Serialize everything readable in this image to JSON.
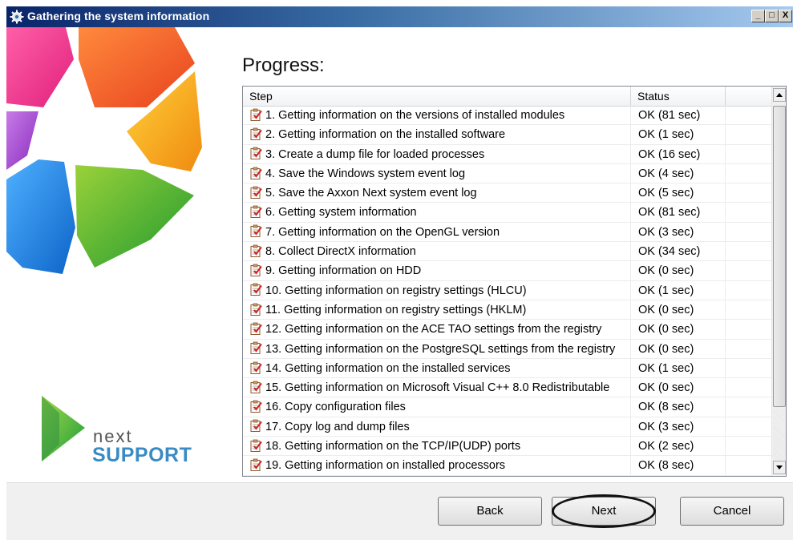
{
  "window": {
    "title": "Gathering the system information",
    "controls": [
      "_",
      "□",
      "X"
    ]
  },
  "brand": {
    "line1": "next",
    "line2": "SUPPORT"
  },
  "heading": "Progress:",
  "table": {
    "columns": [
      "Step",
      "Status"
    ],
    "rows": [
      {
        "step": "1. Getting information on the versions of installed modules",
        "status": "OK (81 sec)"
      },
      {
        "step": "2. Getting information on the installed software",
        "status": "OK (1 sec)"
      },
      {
        "step": "3. Create a dump file for loaded processes",
        "status": "OK (16 sec)"
      },
      {
        "step": "4. Save the Windows system event log",
        "status": "OK (4 sec)"
      },
      {
        "step": "5. Save the Axxon Next system event log",
        "status": "OK (5 sec)"
      },
      {
        "step": "6. Getting system information",
        "status": "OK (81 sec)"
      },
      {
        "step": "7. Getting information on the OpenGL version",
        "status": "OK (3 sec)"
      },
      {
        "step": "8. Collect DirectX information",
        "status": "OK (34 sec)"
      },
      {
        "step": "9. Getting information on HDD",
        "status": "OK (0 sec)"
      },
      {
        "step": "10. Getting information on registry settings (HLCU)",
        "status": "OK (1 sec)"
      },
      {
        "step": "11. Getting information on registry settings (HKLM)",
        "status": "OK (0 sec)"
      },
      {
        "step": "12. Getting information on the ACE TAO settings from the registry",
        "status": "OK (0 sec)"
      },
      {
        "step": "13. Getting information on the PostgreSQL settings from the registry",
        "status": "OK (0 sec)"
      },
      {
        "step": "14. Getting information on the installed services",
        "status": "OK (1 sec)"
      },
      {
        "step": "15. Getting information on Microsoft Visual C++ 8.0 Redistributable",
        "status": "OK (0 sec)"
      },
      {
        "step": "16. Copy configuration files",
        "status": "OK (8 sec)"
      },
      {
        "step": "17. Copy log and dump files",
        "status": "OK (3 sec)"
      },
      {
        "step": "18. Getting  information on the TCP/IP(UDP) ports",
        "status": "OK (2 sec)"
      },
      {
        "step": "19. Getting information on installed processors",
        "status": "OK (8 sec)"
      }
    ],
    "row_icon": "clipboard-check-icon"
  },
  "buttons": {
    "back": "Back",
    "next": "Next",
    "cancel": "Cancel"
  }
}
